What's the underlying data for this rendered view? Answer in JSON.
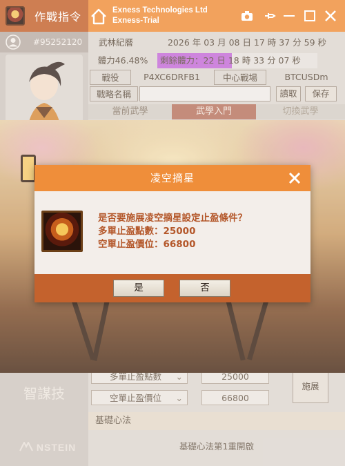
{
  "app": {
    "title": "作戰指令",
    "company_line1": "Exness Technologies Ltd",
    "company_line2": "Exness-Trial",
    "account_id": "#95252120"
  },
  "info": {
    "record_label": "武林紀曆",
    "datetime": "2026 年 03 月 08 日 17 時 37 分 59 秒",
    "stamina_label": "體力",
    "stamina_value": "46.48%",
    "stamina_fill": 0.4648,
    "remaining_label": "剩餘體力：22 日 18 時 33 分 07 秒",
    "battle_label": "戰役",
    "battle_id": "P4XC6DRFB1",
    "center_label": "中心戰場",
    "symbol": "BTCUSDm",
    "strategy_label": "戰略名稱",
    "strategy_value": "",
    "read_button": "讀取",
    "save_button": "保存"
  },
  "tabs": {
    "current": "當前武學",
    "intro": "武學入門",
    "switch": "切換武學"
  },
  "lower": {
    "sidebar_skill": "智謀技",
    "long_tp_select": "多單止盈點數",
    "long_tp_value": "25000",
    "short_tp_select": "空單止盈價位",
    "short_tp_value": "66800",
    "expand_button": "施展",
    "basic_tab": "基礎心法",
    "basic_text": "基礎心法第1重開啟",
    "brand": "NSTEIN"
  },
  "dialog": {
    "title": "凌空摘星",
    "line1": "是否要施展凌空摘星設定止盈條件？",
    "line2": "多單止盈點數：25000",
    "line3": "空單止盈價位：66800",
    "yes": "是",
    "no": "否"
  },
  "colors": {
    "orange": "#ef8e3a",
    "rust": "#c4622d",
    "text_accent": "#b4572a",
    "purple": "#c46bd6"
  }
}
